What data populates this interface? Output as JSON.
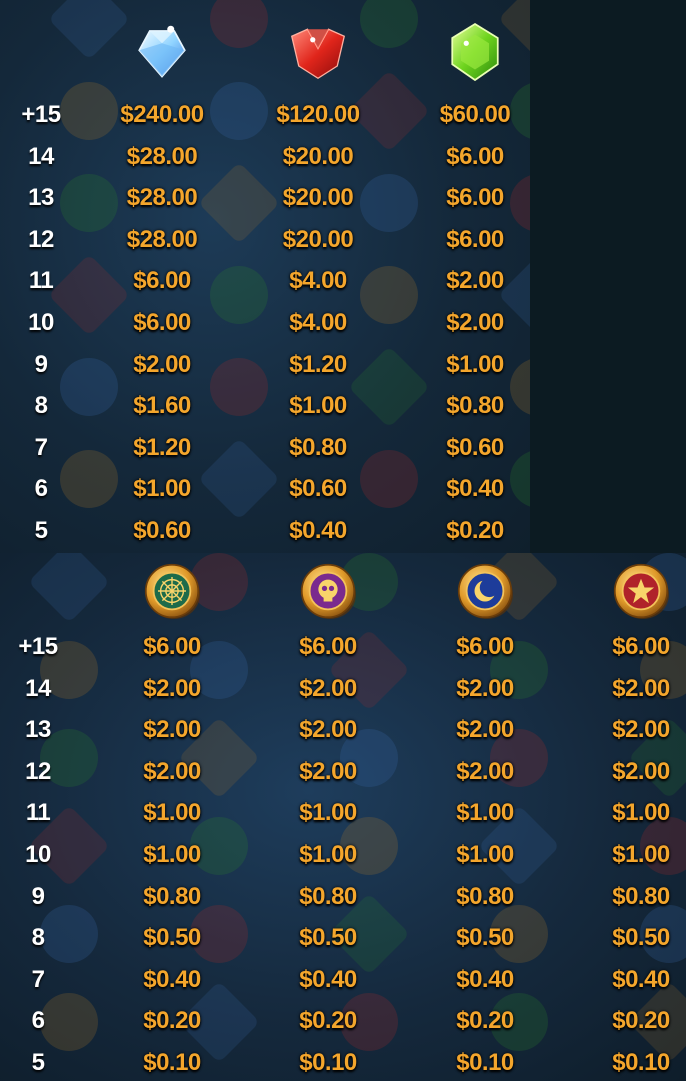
{
  "colors": {
    "value_text": "#f4a62c",
    "row_text": "#ffffff",
    "background": "#14283a"
  },
  "top_table": {
    "icons": [
      "blue-diamond-icon",
      "red-ruby-icon",
      "green-emerald-icon"
    ],
    "rows": [
      {
        "count": "+15",
        "values": [
          "$240.00",
          "$120.00",
          "$60.00"
        ]
      },
      {
        "count": "14",
        "values": [
          "$28.00",
          "$20.00",
          "$6.00"
        ]
      },
      {
        "count": "13",
        "values": [
          "$28.00",
          "$20.00",
          "$6.00"
        ]
      },
      {
        "count": "12",
        "values": [
          "$28.00",
          "$20.00",
          "$6.00"
        ]
      },
      {
        "count": "11",
        "values": [
          "$6.00",
          "$4.00",
          "$2.00"
        ]
      },
      {
        "count": "10",
        "values": [
          "$6.00",
          "$4.00",
          "$2.00"
        ]
      },
      {
        "count": "9",
        "values": [
          "$2.00",
          "$1.20",
          "$1.00"
        ]
      },
      {
        "count": "8",
        "values": [
          "$1.60",
          "$1.00",
          "$0.80"
        ]
      },
      {
        "count": "7",
        "values": [
          "$1.20",
          "$0.80",
          "$0.60"
        ]
      },
      {
        "count": "6",
        "values": [
          "$1.00",
          "$0.60",
          "$0.40"
        ]
      },
      {
        "count": "5",
        "values": [
          "$0.60",
          "$0.40",
          "$0.20"
        ]
      }
    ]
  },
  "bottom_table": {
    "icons": [
      "web-coin-icon",
      "skull-coin-icon",
      "moon-coin-icon",
      "star-coin-icon"
    ],
    "rows": [
      {
        "count": "+15",
        "values": [
          "$6.00",
          "$6.00",
          "$6.00",
          "$6.00"
        ]
      },
      {
        "count": "14",
        "values": [
          "$2.00",
          "$2.00",
          "$2.00",
          "$2.00"
        ]
      },
      {
        "count": "13",
        "values": [
          "$2.00",
          "$2.00",
          "$2.00",
          "$2.00"
        ]
      },
      {
        "count": "12",
        "values": [
          "$2.00",
          "$2.00",
          "$2.00",
          "$2.00"
        ]
      },
      {
        "count": "11",
        "values": [
          "$1.00",
          "$1.00",
          "$1.00",
          "$1.00"
        ]
      },
      {
        "count": "10",
        "values": [
          "$1.00",
          "$1.00",
          "$1.00",
          "$1.00"
        ]
      },
      {
        "count": "9",
        "values": [
          "$0.80",
          "$0.80",
          "$0.80",
          "$0.80"
        ]
      },
      {
        "count": "8",
        "values": [
          "$0.50",
          "$0.50",
          "$0.50",
          "$0.50"
        ]
      },
      {
        "count": "7",
        "values": [
          "$0.40",
          "$0.40",
          "$0.40",
          "$0.40"
        ]
      },
      {
        "count": "6",
        "values": [
          "$0.20",
          "$0.20",
          "$0.20",
          "$0.20"
        ]
      },
      {
        "count": "5",
        "values": [
          "$0.10",
          "$0.10",
          "$0.10",
          "$0.10"
        ]
      }
    ]
  }
}
